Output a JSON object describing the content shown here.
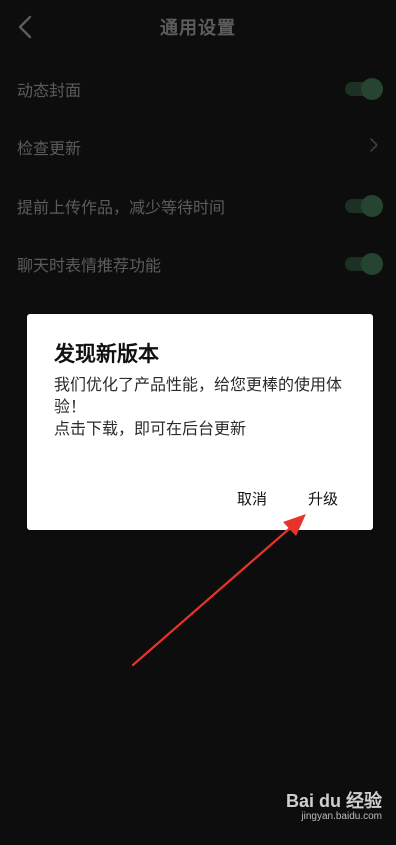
{
  "header": {
    "title": "通用设置",
    "back_icon": "chevron-left-icon"
  },
  "settings": [
    {
      "label": "动态封面",
      "control": "toggle",
      "on": true
    },
    {
      "label": "检查更新",
      "control": "chevron"
    },
    {
      "label": "提前上传作品，减少等待时间",
      "control": "toggle",
      "on": true
    },
    {
      "label": "聊天时表情推荐功能",
      "control": "toggle",
      "on": true
    }
  ],
  "dialog": {
    "title": "发现新版本",
    "message_line1": "我们优化了产品性能，给您更棒的使用体验！",
    "message_line2": "点击下载，即可在后台更新",
    "cancel_label": "取消",
    "upgrade_label": "升级"
  },
  "annotation": {
    "arrow_color": "#e8332a"
  },
  "colors": {
    "background": "#141414",
    "toggle_on": "#3a6a4b",
    "dialog_bg": "#ffffff"
  },
  "watermark": {
    "logo": "Bai du 经验",
    "url": "jingyan.baidu.com"
  }
}
